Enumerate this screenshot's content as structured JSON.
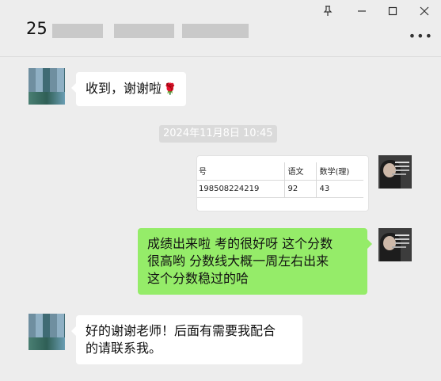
{
  "header": {
    "title_prefix": "25",
    "window_buttons": {
      "pin": "pin-icon",
      "minimize": "minimize-icon",
      "maximize": "maximize-icon",
      "close": "close-icon"
    },
    "more_label": "•••"
  },
  "messages": {
    "m1": {
      "text": "收到，谢谢啦",
      "emoji": "🌹"
    },
    "timestamp": "2024年11月8日 10:45",
    "image_table": {
      "header": [
        "号",
        "语文",
        "数学(理)"
      ],
      "row": [
        "198508224219",
        "92",
        "43"
      ]
    },
    "m2": {
      "line1": "成绩出来啦  考的很好呀  这个分数",
      "line2": "很高哟  分数线大概一周左右出来",
      "line3": "这个分数稳过的哈"
    },
    "m3": {
      "line1": "好的谢谢老师！后面有需要我配合",
      "line2": "的请联系我。"
    }
  },
  "colors": {
    "background": "#ededed",
    "sent_bubble": "#95ec69",
    "received_bubble": "#ffffff",
    "timestamp_bg": "#dadada"
  }
}
